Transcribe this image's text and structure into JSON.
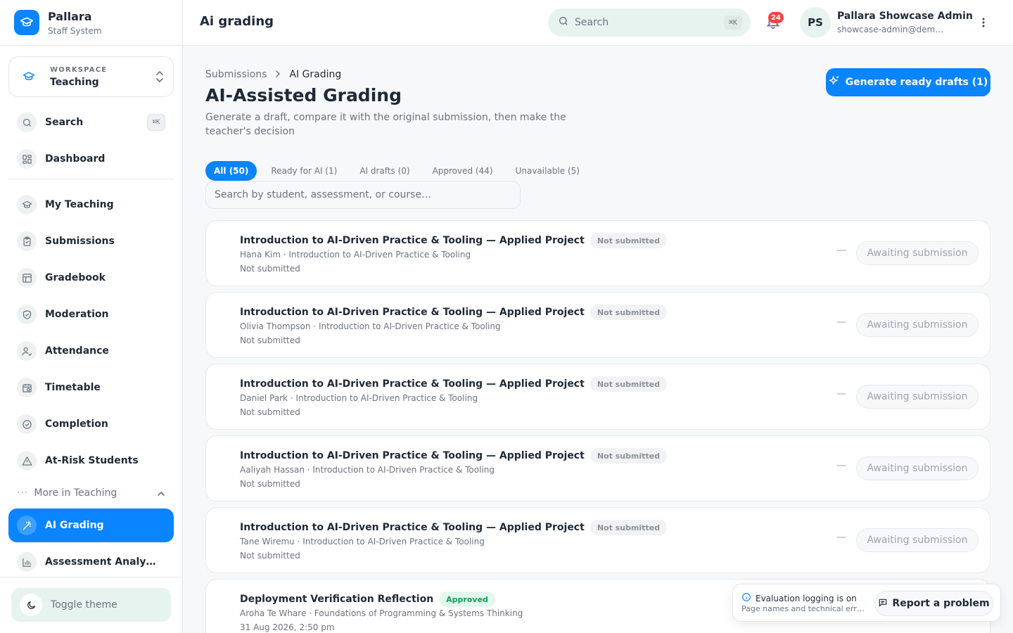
{
  "brand": {
    "name": "Pallara",
    "subtitle": "Staff System"
  },
  "workspace": {
    "label": "WORKSPACE",
    "value": "Teaching"
  },
  "sidebar": {
    "search": {
      "label": "Search",
      "shortcut": "⌘K"
    },
    "items": [
      {
        "label": "Dashboard",
        "icon": "dashboard-icon"
      },
      {
        "label": "My Teaching",
        "icon": "graduation-cap-icon"
      },
      {
        "label": "Submissions",
        "icon": "clipboard-icon"
      },
      {
        "label": "Gradebook",
        "icon": "table-icon"
      },
      {
        "label": "Moderation",
        "icon": "shield-check-icon"
      },
      {
        "label": "Attendance",
        "icon": "user-check-icon"
      },
      {
        "label": "Timetable",
        "icon": "calendar-clock-icon"
      },
      {
        "label": "Completion",
        "icon": "circle-check-icon"
      },
      {
        "label": "At-Risk Students",
        "icon": "warning-triangle-icon"
      }
    ],
    "more_label": "More in Teaching",
    "active_item": {
      "label": "AI Grading",
      "icon": "magic-wand-icon"
    },
    "after_item": {
      "label": "Assessment Analy…",
      "icon": "bar-chart-icon"
    },
    "theme_toggle": "Toggle theme"
  },
  "topbar": {
    "page_title": "Ai grading",
    "search_placeholder": "Search",
    "search_shortcut": "⌘K",
    "notifications_count": "24",
    "user_initials": "PS",
    "user_name": "Pallara Showcase Admin",
    "user_email": "showcase-admin@dem…"
  },
  "breadcrumb": {
    "parent": "Submissions",
    "current": "AI Grading"
  },
  "header": {
    "title": "AI-Assisted Grading",
    "subtitle": "Generate a draft, compare it with the original submission, then make the teacher's decision",
    "generate_button": "Generate ready drafts (1)"
  },
  "tabs": [
    {
      "label": "All (50)",
      "active": true
    },
    {
      "label": "Ready for AI (1)",
      "active": false
    },
    {
      "label": "AI drafts (0)",
      "active": false
    },
    {
      "label": "Approved (44)",
      "active": false
    },
    {
      "label": "Unavailable (5)",
      "active": false
    }
  ],
  "list_search_placeholder": "Search by student, assessment, or course…",
  "submissions": [
    {
      "title": "Introduction to AI-Driven Practice & Tooling — Applied Project",
      "status": "Not submitted",
      "meta": "Hana Kim · Introduction to AI-Driven Practice & Tooling",
      "date": "Not submitted",
      "score": "—",
      "action": "Awaiting submission"
    },
    {
      "title": "Introduction to AI-Driven Practice & Tooling — Applied Project",
      "status": "Not submitted",
      "meta": "Olivia Thompson · Introduction to AI-Driven Practice & Tooling",
      "date": "Not submitted",
      "score": "—",
      "action": "Awaiting submission"
    },
    {
      "title": "Introduction to AI-Driven Practice & Tooling — Applied Project",
      "status": "Not submitted",
      "meta": "Daniel Park · Introduction to AI-Driven Practice & Tooling",
      "date": "Not submitted",
      "score": "—",
      "action": "Awaiting submission"
    },
    {
      "title": "Introduction to AI-Driven Practice & Tooling — Applied Project",
      "status": "Not submitted",
      "meta": "Aaliyah Hassan · Introduction to AI-Driven Practice & Tooling",
      "date": "Not submitted",
      "score": "—",
      "action": "Awaiting submission"
    },
    {
      "title": "Introduction to AI-Driven Practice & Tooling — Applied Project",
      "status": "Not submitted",
      "meta": "Tane Wiremu · Introduction to AI-Driven Practice & Tooling",
      "date": "Not submitted",
      "score": "—",
      "action": "Awaiting submission"
    },
    {
      "title": "Deployment Verification Reflection",
      "status": "Approved",
      "meta": "Aroha Te Whare · Foundations of Programming & Systems Thinking",
      "date": "31 Aug 2026, 2:50 pm"
    }
  ],
  "logging": {
    "title": "Evaluation logging is on",
    "subtitle": "Page names and technical err…",
    "report_button": "Report a problem"
  },
  "colors": {
    "accent": "#0a84ff",
    "mint": "#e7f3ef",
    "danger": "#ef4444",
    "success": "#0f9d58"
  }
}
